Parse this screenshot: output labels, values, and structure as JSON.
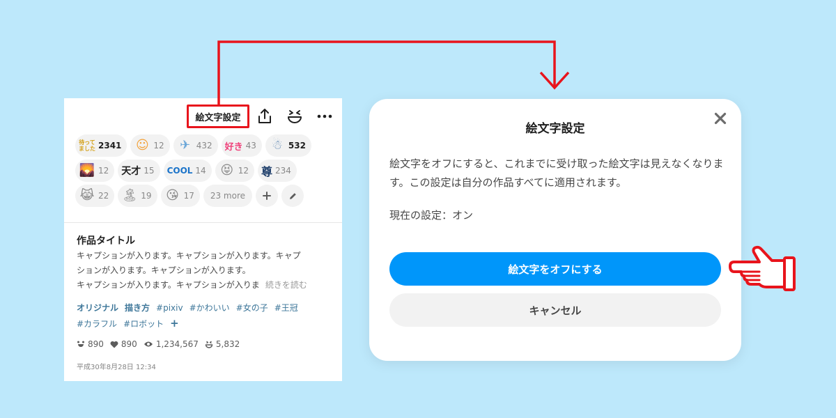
{
  "toolbar": {
    "emoji_setting_label": "絵文字設定"
  },
  "reactions": {
    "row1": [
      {
        "emoji_text": "待って\nました",
        "count": "2341",
        "bold": true
      },
      {
        "emoji": "☺",
        "count": "12"
      },
      {
        "emoji": "✈",
        "count": "432"
      },
      {
        "emoji_text": "好き",
        "count": "43"
      },
      {
        "emoji": "☃",
        "count": "532",
        "bold": true
      }
    ],
    "row2": [
      {
        "emoji": "🌄",
        "count": "12"
      },
      {
        "emoji_text": "天才",
        "count": "15"
      },
      {
        "emoji_text": "COOL",
        "count": "14"
      },
      {
        "emoji": "😝",
        "count": "12"
      },
      {
        "emoji_text": "尊",
        "count": "234"
      }
    ],
    "row3": [
      {
        "emoji": "😹",
        "count": "22"
      },
      {
        "emoji": "🏝",
        "count": "19"
      },
      {
        "emoji": "😘",
        "count": "17"
      }
    ],
    "more_label": "23 more"
  },
  "work": {
    "title": "作品タイトル",
    "caption_lines": [
      "キャプションが入ります。キャプションが入ります。キャプ",
      "ションが入ります。キャプションが入ります。",
      "キャプションが入ります。キャプションが入りま"
    ],
    "read_more": "続きを読む",
    "tags": [
      "オリジナル",
      "描き方",
      "#pixiv",
      "#かわいい",
      "#女の子",
      "#王冠",
      "#カラフル",
      "#ロボット"
    ],
    "stats": {
      "likes": "890",
      "bookmarks": "890",
      "views": "1,234,567",
      "reactions": "5,832"
    },
    "date": "平成30年8月28日 12:34"
  },
  "dialog": {
    "title": "絵文字設定",
    "body": "絵文字をオフにすると、これまでに受け取った絵文字は見えなくなります。この設定は自分の作品すべてに適用されます。",
    "current_setting": "現在の設定：オン",
    "primary_button": "絵文字をオフにする",
    "secondary_button": "キャンセル"
  },
  "colors": {
    "background": "#bde8fb",
    "accent": "#0096fa",
    "highlight": "#e8141c",
    "tag": "#3d7699"
  }
}
